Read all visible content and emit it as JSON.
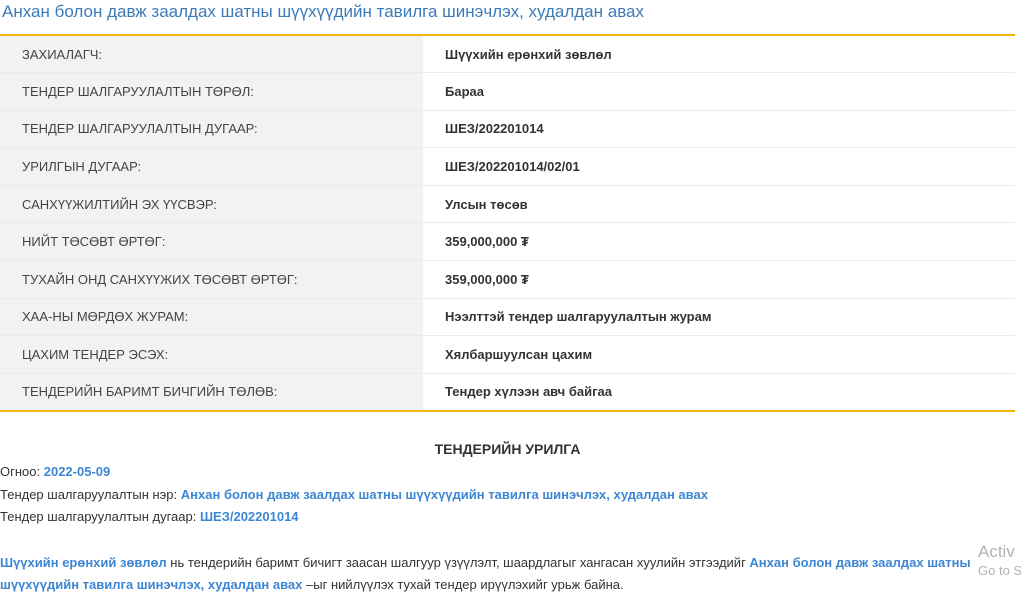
{
  "page": {
    "title": "Анхан болон давж заалдах шатны шүүхүүдийн тавилга шинэчлэх, худалдан авах"
  },
  "info_rows": [
    {
      "label": "ЗАХИАЛАГЧ:",
      "value": "Шүүхийн ерөнхий зөвлөл"
    },
    {
      "label": "ТЕНДЕР ШАЛГАРУУЛАЛТЫН ТӨРӨЛ:",
      "value": "Бараа"
    },
    {
      "label": "ТЕНДЕР ШАЛГАРУУЛАЛТЫН ДУГААР:",
      "value": "ШЕЗ/202201014"
    },
    {
      "label": "УРИЛГЫН ДУГААР:",
      "value": "ШЕЗ/202201014/02/01"
    },
    {
      "label": "САНХҮҮЖИЛТИЙН ЭХ ҮҮСВЭР:",
      "value": "Улсын төсөв"
    },
    {
      "label": "НИЙТ ТӨСӨВТ ӨРТӨГ:",
      "value": "359,000,000 ₮"
    },
    {
      "label": "ТУХАЙН ОНД САНХҮҮЖИХ ТӨСӨВТ ӨРТӨГ:",
      "value": "359,000,000 ₮"
    },
    {
      "label": "ХАА-НЫ МӨРДӨХ ЖУРАМ:",
      "value": "Нээлттэй тендер шалгаруулалтын журам"
    },
    {
      "label": "ЦАХИМ ТЕНДЕР ЭСЭХ:",
      "value": "Хялбаршуулсан цахим"
    },
    {
      "label": "ТЕНДЕРИЙН БАРИМТ БИЧГИЙН ТӨЛӨВ:",
      "value": "Тендер хүлээн авч байгаа"
    }
  ],
  "invitation": {
    "heading": "ТЕНДЕРИЙН УРИЛГА",
    "date_label": "Огноо:",
    "date_value": "2022-05-09",
    "name_label": "Тендер шалгаруулалтын нэр:",
    "name_value": "Анхан болон давж заалдах шатны шүүхүүдийн тавилга шинэчлэх, худалдан авах",
    "number_label": "Тендер шалгаруулалтын дугаар:",
    "number_value": "ШЕЗ/202201014",
    "body_org": "Шүүхийн ерөнхий зөвлөл",
    "body_text1": " нь тендерийн баримт бичигт заасан шалгуур үзүүлэлт, шаардлагыг хангасан хуулийн этгээдийг ",
    "body_tender": "Анхан болон давж заалдах шатны шүүхүүдийн тавилга шинэчлэх, худалдан авах",
    "body_text2": " –ыг нийлүүлэх тухай тендер ирүүлэхийг урьж байна."
  },
  "watermark": {
    "line1": "Activ",
    "line2": "Go to S"
  },
  "colors": {
    "accent_yellow": "#f0b90b",
    "link_blue": "#3d86d4",
    "title_blue": "#3d7ab8"
  }
}
